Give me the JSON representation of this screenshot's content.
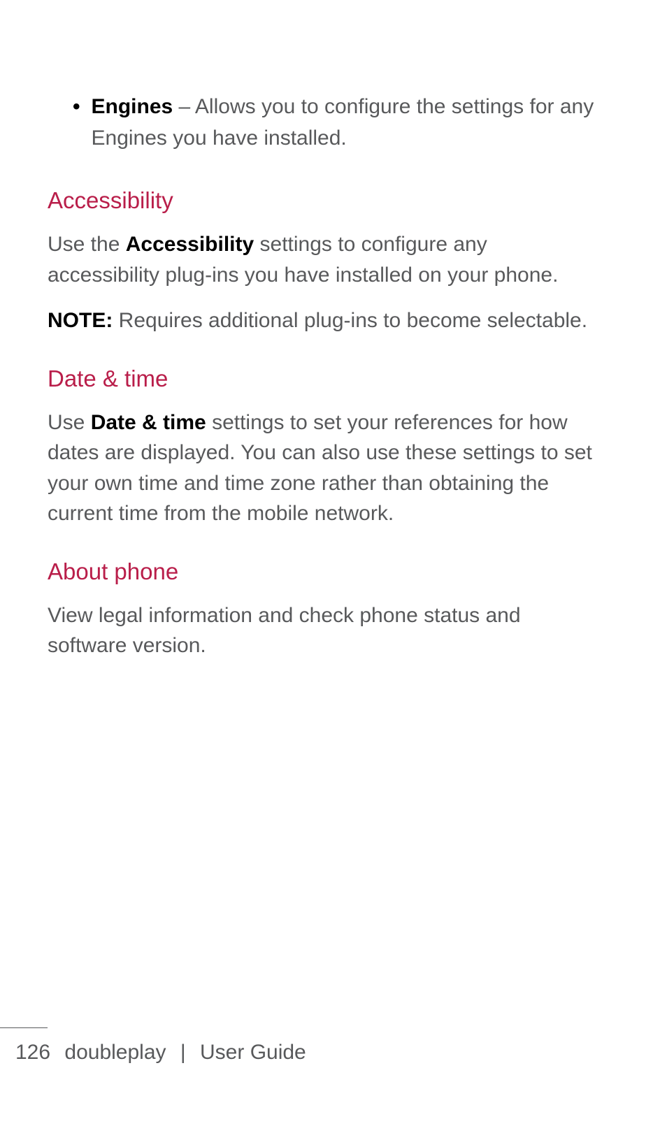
{
  "bullet": {
    "label": "Engines",
    "description": " – Allows you to configure the settings for any Engines you have installed."
  },
  "sections": {
    "accessibility": {
      "heading": "Accessibility",
      "para1_prefix": "Use the ",
      "para1_bold": "Accessibility",
      "para1_suffix": " settings to configure any accessibility plug-ins you have installed on your phone.",
      "note_label": "NOTE:",
      "note_text": " Requires additional plug-ins to become selectable."
    },
    "datetime": {
      "heading": "Date & time",
      "para_prefix": "Use ",
      "para_bold": "Date & time",
      "para_suffix": " settings to set your references for how dates are displayed. You can also use these settings to set your own time and time zone rather than obtaining the current time from the mobile network."
    },
    "about": {
      "heading": "About phone",
      "para": "View legal information and check phone status and software version."
    }
  },
  "footer": {
    "page": "126",
    "product": "doubleplay",
    "separator": "|",
    "doc": "User Guide"
  }
}
